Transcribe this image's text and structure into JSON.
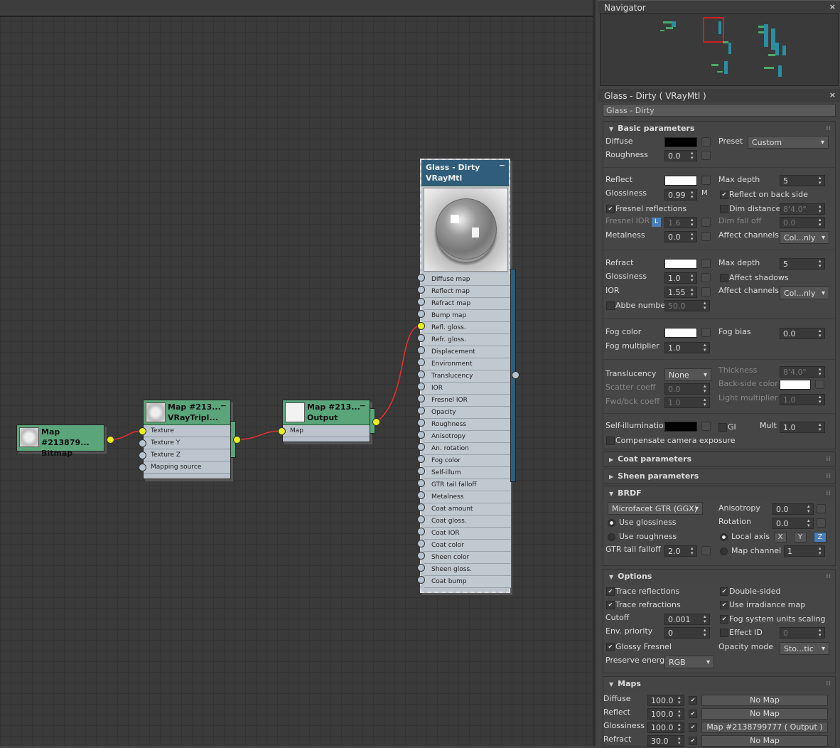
{
  "navigator": {
    "title": "Navigator"
  },
  "nodes": {
    "bitmap": {
      "line1": "Map #213879...",
      "line2": "Bitmap"
    },
    "triplanar": {
      "line1": "Map #213...",
      "line2": "VRayTripl...",
      "ports": [
        "Texture",
        "Texture Y",
        "Texture Z",
        "Mapping source"
      ]
    },
    "output": {
      "line1": "Map #213...",
      "line2": "Output",
      "ports": [
        "Map"
      ]
    },
    "material": {
      "line1": "Glass - Dirty",
      "line2": "VRayMtl",
      "ports": [
        "Diffuse map",
        "Reflect map",
        "Refract map",
        "Bump map",
        "Refl. gloss.",
        "Refr. gloss.",
        "Displacement",
        "Environment",
        "Translucency",
        "IOR",
        "Fresnel IOR",
        "Opacity",
        "Roughness",
        "Anisotropy",
        "An. rotation",
        "Fog color",
        "Self-illum",
        "GTR tail falloff",
        "Metalness",
        "Coat amount",
        "Coat gloss.",
        "Coat IOR",
        "Coat color",
        "Sheen color",
        "Sheen gloss.",
        "Coat bump"
      ]
    }
  },
  "panel": {
    "title": "Glass - Dirty  ( VRayMtl )",
    "name": "Glass - Dirty",
    "basic": {
      "header": "Basic parameters",
      "diffuse": "Diffuse",
      "preset": "Preset",
      "preset_val": "Custom",
      "roughness": "Roughness",
      "roughness_val": "0.0",
      "reflect": "Reflect",
      "maxdepth": "Max depth",
      "maxdepth_val": "5",
      "glossiness": "Glossiness",
      "gloss_val": "0.99",
      "m": "M",
      "reflback": "Reflect on back side",
      "fresnel": "Fresnel reflections",
      "dimdist": "Dim distance",
      "dimdist_val": "8'4.0\"",
      "fresnelior": "Fresnel IOR",
      "l": "L",
      "fresnelior_val": "1.6",
      "dimfall": "Dim fall off",
      "dimfall_val": "0.0",
      "metalness": "Metalness",
      "metal_val": "0.0",
      "affect": "Affect channels",
      "affect_val": "Col...nly",
      "refract": "Refract",
      "rmaxdepth": "Max depth",
      "rmaxdepth_val": "5",
      "rgloss": "Glossiness",
      "rgloss_val": "1.0",
      "affshadows": "Affect shadows",
      "ior": "IOR",
      "ior_val": "1.55",
      "raffect": "Affect channels",
      "raffect_val": "Col...nly",
      "abbe": "Abbe number",
      "abbe_val": "50.0",
      "fogcolor": "Fog color",
      "fogbias": "Fog bias",
      "fogbias_val": "0.0",
      "fogmult": "Fog multiplier",
      "fogmult_val": "1.0",
      "transl": "Translucency",
      "transl_val": "None",
      "thickness": "Thickness",
      "thickness_val": "8'4.0\"",
      "scatter": "Scatter coeff",
      "scatter_val": "0.0",
      "backside": "Back-side color",
      "fwdbck": "Fwd/bck coeff",
      "fwdbck_val": "1.0",
      "lightmult": "Light multiplier",
      "lightmult_val": "1.0",
      "selfillum": "Self-illumination",
      "gi": "GI",
      "mult": "Mult",
      "mult_val": "1.0",
      "compensate": "Compensate camera exposure"
    },
    "coat": "Coat parameters",
    "sheen": "Sheen parameters",
    "brdf": {
      "header": "BRDF",
      "type": "Microfacet GTR (GGX)",
      "aniso": "Anisotropy",
      "aniso_val": "0.0",
      "useg": "Use glossiness",
      "rotation": "Rotation",
      "rot_val": "0.0",
      "user": "Use roughness",
      "localaxis": "Local axis",
      "ax": "X",
      "ay": "Y",
      "az": "Z",
      "gtr": "GTR tail falloff",
      "gtr_val": "2.0",
      "mapch": "Map channel",
      "mapch_val": "1"
    },
    "options": {
      "header": "Options",
      "tracerefl": "Trace reflections",
      "double": "Double-sided",
      "tracerefr": "Trace refractions",
      "irr": "Use irradiance map",
      "fogunits": "Fog system units scaling",
      "cutoff": "Cutoff",
      "cutoff_val": "0.001",
      "envprio": "Env. priority",
      "envprio_val": "0",
      "effectid": "Effect ID",
      "effectid_val": "0",
      "glossyf": "Glossy Fresnel",
      "opmode": "Opacity mode",
      "opmode_val": "Sto...tic",
      "preserve": "Preserve energy",
      "preserve_val": "RGB"
    },
    "maps": {
      "header": "Maps",
      "rows": [
        {
          "name": "Diffuse",
          "amt": "100.0",
          "map": "No Map"
        },
        {
          "name": "Reflect",
          "amt": "100.0",
          "map": "No Map"
        },
        {
          "name": "Glossiness",
          "amt": "100.0",
          "map": "Map #2138799777  ( Output )"
        },
        {
          "name": "Refract",
          "amt": "30.0",
          "map": "No Map"
        }
      ]
    }
  },
  "colors": {
    "node_green": "#5aa57a",
    "mat_blue": "#2f5d7a",
    "wire": "#e03030",
    "socket_active": "#e8f020",
    "accent_blue": "#4a7eb8"
  }
}
